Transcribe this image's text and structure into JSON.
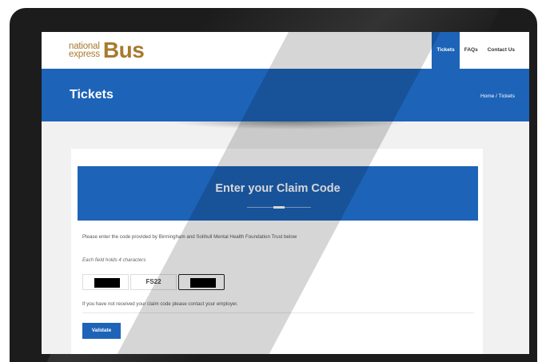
{
  "navbar": {
    "logo": {
      "line1": "national",
      "line2": "express",
      "brand": "Bus"
    },
    "items": [
      {
        "label": "Tickets",
        "active": true
      },
      {
        "label": "FAQs",
        "active": false
      },
      {
        "label": "Contact Us",
        "active": false
      }
    ]
  },
  "banner": {
    "title": "Tickets",
    "breadcrumb": {
      "home": "Home",
      "separator": "/",
      "current": "Tickets"
    }
  },
  "claim": {
    "title": "Enter your Claim Code",
    "instruction": "Please enter the code provided by Birmingham and Solihull Mental Health Foundation Trust below",
    "hint": "Each field holds 4 characters",
    "fields": [
      {
        "value": "",
        "redacted": true
      },
      {
        "value": "FS22",
        "redacted": false
      },
      {
        "value": "",
        "redacted": true,
        "focused": true
      }
    ],
    "contact_note": "If you have not received your claim code please contact your employer.",
    "validate_label": "Validate"
  },
  "colors": {
    "primary": "#1d63b8",
    "logo": "#a8792e"
  }
}
